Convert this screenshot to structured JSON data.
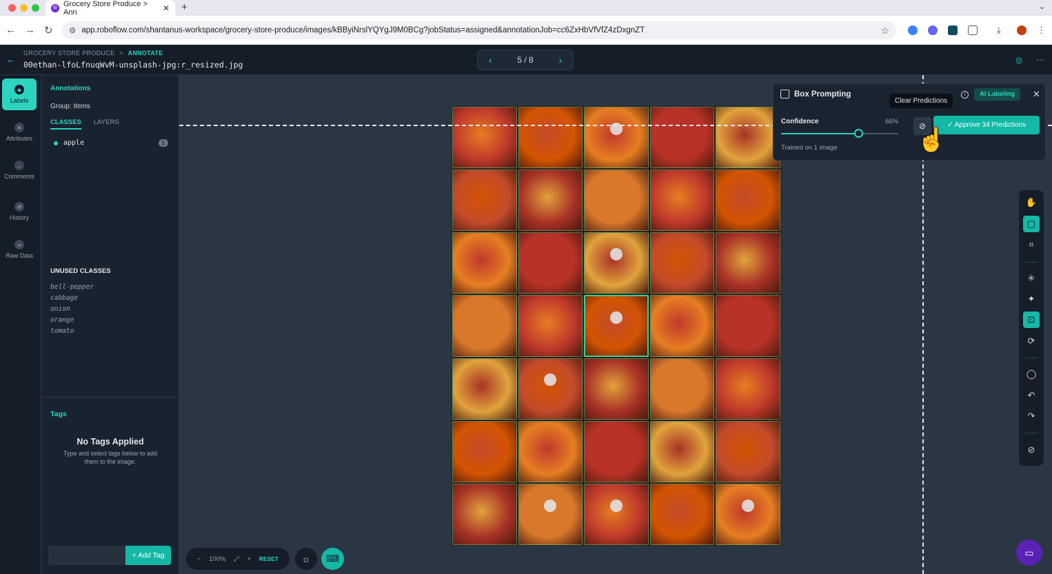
{
  "browser": {
    "tab_title": "Grocery Store Produce > Ann",
    "favicon_letter": "R",
    "url": "app.roboflow.com/shantanus-workspace/grocery-store-produce/images/kBByiNrslYQYgJ9M0BCg?jobStatus=assigned&annotationJob=cc6ZxHbVfVfZ4zDxgnZT"
  },
  "header": {
    "project": "GROCERY STORE PRODUCE",
    "separator": ">",
    "mode": "ANNOTATE",
    "filename": "00ethan-lfoLfnuqWvM-unsplash-jpg:r_resized.jpg",
    "pager": "5 / 8"
  },
  "rail": {
    "items": [
      {
        "label": "Labels"
      },
      {
        "label": "Attributes"
      },
      {
        "label": "Comments"
      },
      {
        "label": "History"
      },
      {
        "label": "Raw Data"
      }
    ]
  },
  "sidebar": {
    "title": "Annotations",
    "group": "Group: Items",
    "tab_classes": "CLASSES",
    "tab_layers": "LAYERS",
    "classes": [
      {
        "name": "apple",
        "count": "1"
      }
    ],
    "unused_title": "UNUSED CLASSES",
    "unused": [
      "bell-pepper",
      "cabbage",
      "onion",
      "orange",
      "tomato"
    ],
    "tags_title": "Tags",
    "no_tags": "No Tags Applied",
    "no_tags_sub": "Type and select tags below to add them to the image.",
    "add_tag": "+ Add Tag"
  },
  "box_prompting": {
    "title": "Box Prompting",
    "tooltip": "Clear Predictions",
    "ai_labeling": "AI Labeling",
    "confidence_label": "Confidence",
    "confidence_value": "66%",
    "confidence_fraction": 0.66,
    "trained": "Trained on 1 image",
    "approve": "✓ Approve 34 Predictions"
  },
  "zoom": {
    "minus": "−",
    "level": "100%",
    "plus": "+",
    "reset": "RESET"
  },
  "colors": {
    "accent": "#2dd4bf",
    "box": "#34d399"
  }
}
